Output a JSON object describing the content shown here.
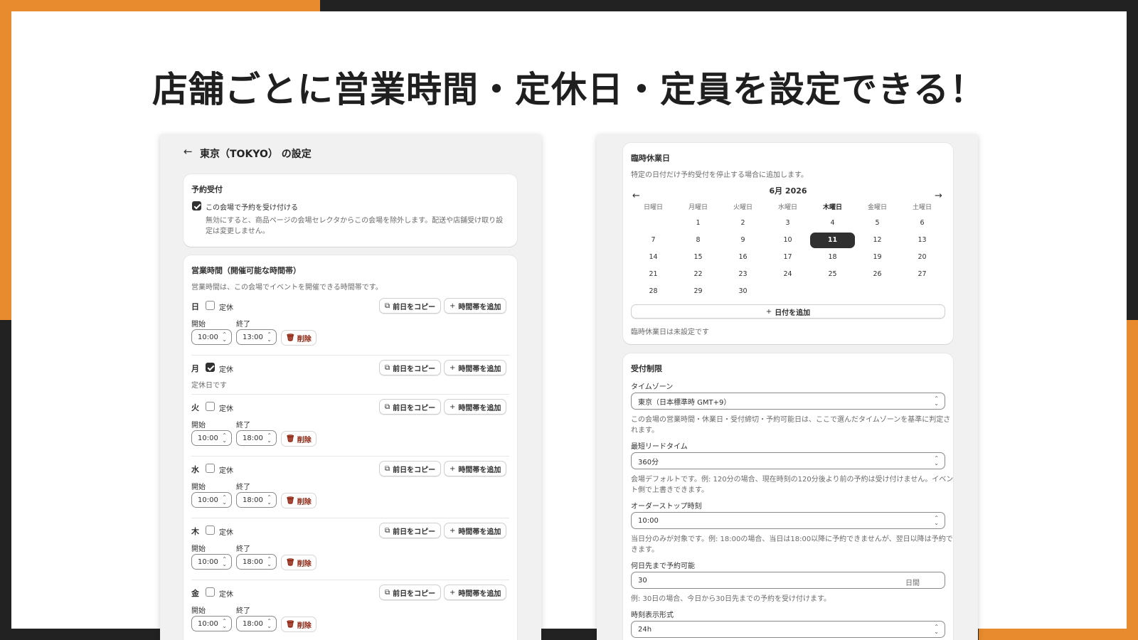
{
  "headline": "店舗ごとに営業時間・定休日・定員を設定できる！",
  "left": {
    "page_title": "東京（TOKYO） の設定",
    "reservation": {
      "title": "予約受付",
      "checkbox_label": "この会場で予約を受け付ける",
      "checked": true,
      "help": "無効にすると、商品ページの会場セレクタからこの会場を除外します。配送や店舗受け取り設定は変更しません。",
      "help_l1": "無効にすると、商品ページの会場セレクタからこの会場を除外します。配送や店舗受け取り設",
      "help_l2": "定は変更しません。"
    },
    "hours": {
      "title": "営業時間（開催可能な時間帯）",
      "subtitle": "営業時間は、この会場でイベントを開催できる時間帯です。",
      "closed_label": "定休",
      "copy_label": "前日をコピー",
      "add_label": "時間帯を追加",
      "start_label": "開始",
      "end_label": "終了",
      "delete_label": "削除",
      "closed_msg": "定休日です",
      "days": [
        {
          "name": "日",
          "closed": false,
          "start": "10:00",
          "end": "13:00"
        },
        {
          "name": "月",
          "closed": true
        },
        {
          "name": "火",
          "closed": false,
          "start": "10:00",
          "end": "18:00"
        },
        {
          "name": "水",
          "closed": false,
          "start": "10:00",
          "end": "18:00"
        },
        {
          "name": "木",
          "closed": false,
          "start": "10:00",
          "end": "18:00"
        },
        {
          "name": "金",
          "closed": false,
          "start": "10:00",
          "end": "18:00"
        }
      ]
    }
  },
  "right": {
    "holiday": {
      "title": "臨時休業日",
      "subtitle": "特定の日付だけ予約受付を停止する場合に追加します。",
      "month": "6月 2026",
      "weekdays": [
        "日曜日",
        "月曜日",
        "火曜日",
        "水曜日",
        "木曜日",
        "金曜日",
        "土曜日"
      ],
      "weeks": [
        [
          "",
          "1",
          "2",
          "3",
          "4",
          "5",
          "6"
        ],
        [
          "7",
          "8",
          "9",
          "10",
          "11",
          "12",
          "13"
        ],
        [
          "14",
          "15",
          "16",
          "17",
          "18",
          "19",
          "20"
        ],
        [
          "21",
          "22",
          "23",
          "24",
          "25",
          "26",
          "27"
        ],
        [
          "28",
          "29",
          "30",
          "",
          "",
          "",
          ""
        ]
      ],
      "selected": "11",
      "add_date": "日付を追加",
      "none_msg": "臨時休業日は未設定です"
    },
    "limits": {
      "title": "受付制限",
      "timezone_label": "タイムゾーン",
      "timezone_value": "東京（日本標準時 GMT+9）",
      "timezone_help": "この会場の営業時間・休業日・受付締切・予約可能日は、ここで選んだタイムゾーンを基準に判定されます。",
      "timezone_help_l1": "この会場の営業時間・休業日・受付締切・予約可能日は、ここで選んだタイムゾーンを基準に判定さ",
      "timezone_help_l2": "れます。",
      "lead_label": "最短リードタイム",
      "lead_value": "360分",
      "lead_help": "会場デフォルトです。例: 120分の場合、現在時刻の120分後より前の予約は受け付けません。イベント側で上書きできます。",
      "lead_help_l1": "会場デフォルトです。例: 120分の場合、現在時刻の120分後より前の予約は受け付けません。イベン",
      "lead_help_l2": "ト側で上書きできます。",
      "stop_label": "オーダーストップ時刻",
      "stop_value": "10:00",
      "stop_help": "当日分のみが対象です。例: 18:00の場合、当日は18:00以降に予約できませんが、翌日以降は予約できます。",
      "stop_help_l1": "当日分のみが対象です。例: 18:00の場合、当日は18:00以降に予約できませんが、翌日以降は予約で",
      "stop_help_l2": "きます。",
      "days_label": "何日先まで予約可能",
      "days_value": "30",
      "days_unit": "日間",
      "days_help": "例: 30日の場合、今日から30日先までの予約を受け付けます。",
      "format_label": "時刻表示形式",
      "format_value": "24h"
    }
  },
  "colors": {
    "orange": "#E88B2E",
    "dark": "#222222",
    "accent_dark": "#303030",
    "danger": "#8e1f0b"
  }
}
